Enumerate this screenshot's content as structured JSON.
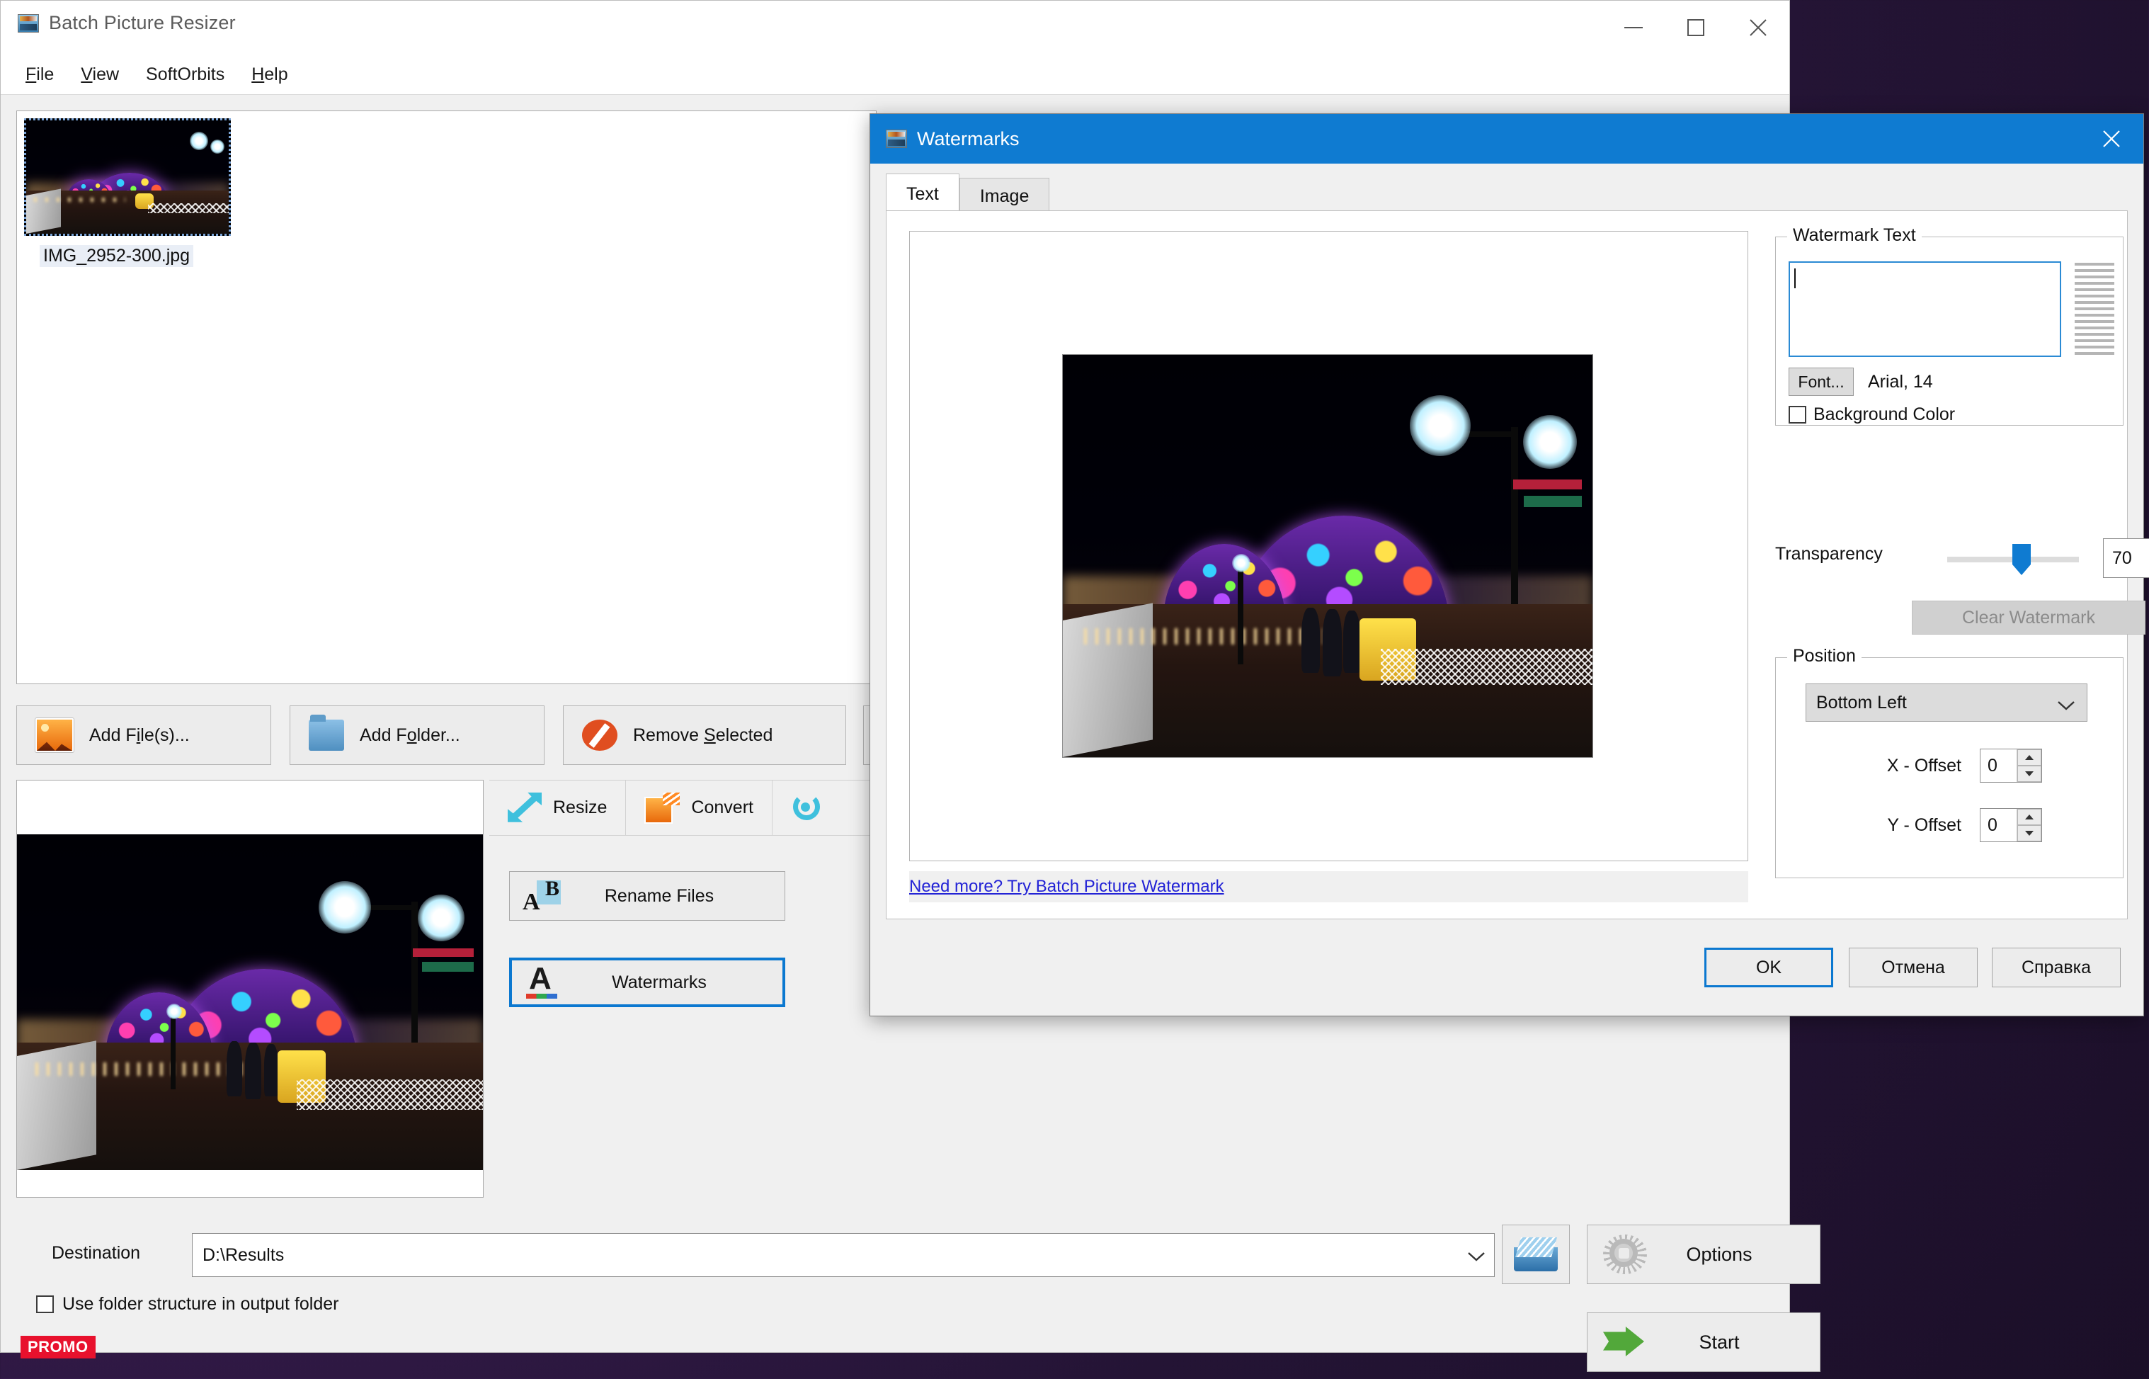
{
  "desktop": {
    "wallpaper_color": "#3a1d52"
  },
  "main_window": {
    "title": "Batch Picture Resizer",
    "app_icon": "picture-app-icon",
    "window_controls": {
      "minimize": "minimize-icon",
      "maximize": "maximize-icon",
      "close": "close-icon"
    },
    "menu": [
      {
        "label": "File",
        "accel": "F"
      },
      {
        "label": "View",
        "accel": "V"
      },
      {
        "label": "SoftOrbits",
        "accel": ""
      },
      {
        "label": "Help",
        "accel": "H"
      }
    ],
    "file_list": [
      {
        "filename": "IMG_2952-300.jpg",
        "selected": true
      }
    ],
    "toolbar": [
      {
        "label": "Add File(s)...",
        "icon": "add-photo-icon"
      },
      {
        "label": "Add Folder...",
        "icon": "folder-icon"
      },
      {
        "label": "Remove Selected",
        "icon": "no-entry-icon"
      },
      {
        "label": "",
        "icon": "orange-arrows-icon"
      }
    ],
    "tabs": [
      {
        "label": "Resize",
        "icon": "resize-arrows-icon",
        "active": false
      },
      {
        "label": "Convert",
        "icon": "convert-photo-icon",
        "active": false
      },
      {
        "label": "",
        "icon": "rotate-icon",
        "active": false
      }
    ],
    "action_buttons": [
      {
        "label": "Rename Files",
        "icon": "rename-ab-icon",
        "focused": false
      },
      {
        "label": "Watermarks",
        "icon": "watermark-a-icon",
        "focused": true
      }
    ],
    "destination": {
      "label": "Destination",
      "value": "D:\\Results",
      "dropdown_icon": "chevron-down-icon",
      "browse_icon": "open-folder-icon"
    },
    "use_folder_structure": {
      "label": "Use folder structure in output folder",
      "checked": false
    },
    "promo_badge": "PROMO",
    "options_button": {
      "label": "Options",
      "icon": "gear-icon"
    },
    "start_button": {
      "label": "Start",
      "icon": "green-arrow-icon"
    }
  },
  "dialog": {
    "title": "Watermarks",
    "app_icon": "picture-app-icon",
    "close_icon": "close-icon",
    "tabs": [
      {
        "label": "Text",
        "active": true
      },
      {
        "label": "Image",
        "active": false
      }
    ],
    "needmore_link": "Need more? Try Batch Picture Watermark",
    "watermark_text_group": {
      "legend": "Watermark Text",
      "textarea_value": "",
      "textarea_placeholder": "",
      "alignment_preview_icon": "text-lines-icon",
      "font_button": "Font...",
      "font_description": "Arial, 14",
      "background_color": {
        "label": "Background Color",
        "checked": false
      }
    },
    "transparency": {
      "label": "Transparency",
      "value": "70",
      "slider_percent": 55
    },
    "clear_watermark": {
      "label": "Clear Watermark",
      "enabled": false
    },
    "position_group": {
      "legend": "Position",
      "selected": "Bottom Left",
      "dropdown_icon": "chevron-down-icon",
      "x_offset": {
        "label": "X - Offset",
        "value": "0"
      },
      "y_offset": {
        "label": "Y - Offset",
        "value": "0"
      }
    },
    "footer_buttons": [
      {
        "label": "OK",
        "primary": true
      },
      {
        "label": "Отмена",
        "primary": false
      },
      {
        "label": "Справка",
        "primary": false
      }
    ]
  },
  "accent_colors": {
    "title_blue": "#0f7bd1",
    "focus_blue": "#0b78d0",
    "link_blue": "#2323d6",
    "promo_red": "#e8112d",
    "start_green": "#52a83a"
  }
}
